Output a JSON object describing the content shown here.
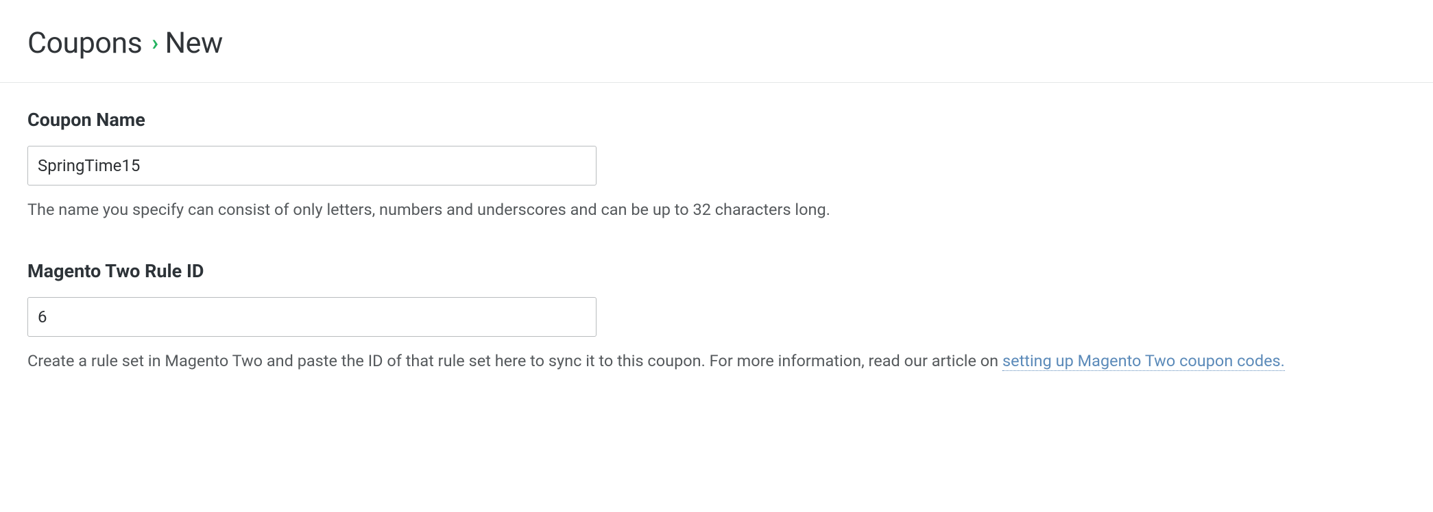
{
  "breadcrumb": {
    "parent": "Coupons",
    "current": "New"
  },
  "form": {
    "couponName": {
      "label": "Coupon Name",
      "value": "SpringTime15",
      "hint": "The name you specify can consist of only letters, numbers and underscores and can be up to 32 characters long."
    },
    "ruleId": {
      "label": "Magento Two Rule ID",
      "value": "6",
      "hintPrefix": "Create a rule set in Magento Two and paste the ID of that rule set here to sync it to this coupon. For more information, read our article on ",
      "linkText": "setting up Magento Two coupon codes."
    }
  }
}
